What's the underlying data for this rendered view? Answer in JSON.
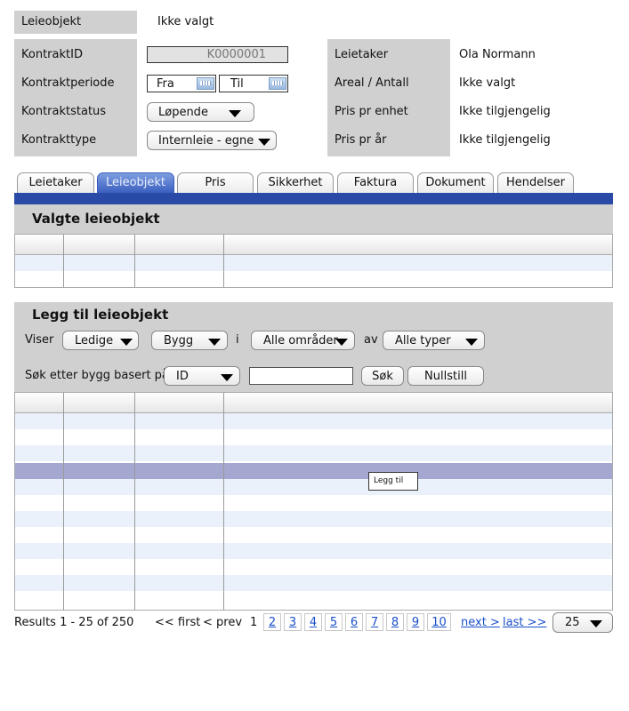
{
  "header": {
    "leieobjekt_label": "Leieobjekt",
    "leieobjekt_value": "Ikke valgt"
  },
  "contract": {
    "kontraktid_label": "KontraktID",
    "kontraktid_value": "K0000001",
    "kontraktperiode_label": "Kontraktperiode",
    "fra_label": "Fra",
    "til_label": "Til",
    "kontraktstatus_label": "Kontraktstatus",
    "kontraktstatus_value": "Løpende",
    "kontrakttype_label": "Kontrakttype",
    "kontrakttype_value": "Internleie - egne"
  },
  "summary": {
    "leietaker_label": "Leietaker",
    "leietaker_value": "Ola Normann",
    "areal_label": "Areal / Antall",
    "areal_value": "Ikke valgt",
    "pris_enhet_label": "Pris pr enhet",
    "pris_enhet_value": "Ikke tilgjengelig",
    "pris_aar_label": "Pris pr år",
    "pris_aar_value": "Ikke tilgjengelig"
  },
  "tabs": [
    {
      "label": "Leietaker"
    },
    {
      "label": "Leieobjekt"
    },
    {
      "label": "Pris"
    },
    {
      "label": "Sikkerhet"
    },
    {
      "label": "Faktura"
    },
    {
      "label": "Dokument"
    },
    {
      "label": "Hendelser"
    }
  ],
  "selected_section": {
    "title": "Valgte leieobjekt"
  },
  "add_section": {
    "title": "Legg til leieobjekt",
    "viser_label": "Viser",
    "filter_status": "Ledige",
    "filter_type": "Bygg",
    "i_label": "i",
    "filter_area": "Alle områder",
    "av_label": "av",
    "filter_kind": "Alle typer",
    "search_label": "Søk etter bygg basert på",
    "search_field": "ID",
    "search_value": "",
    "search_button": "Søk",
    "reset_button": "Nullstill",
    "add_tooltip": "Legg til"
  },
  "pagination": {
    "results_text": "Results 1 - 25 of 250",
    "first": "<< first",
    "prev": "< prev",
    "current": "1",
    "pages": [
      "2",
      "3",
      "4",
      "5",
      "6",
      "7",
      "8",
      "9",
      "10"
    ],
    "next": "next >",
    "last": "last >>",
    "per_page": "25"
  },
  "colors": {
    "panel_grey": "#d0d0d0",
    "tab_active": "#3a5fbf",
    "tab_bar": "#2a4aa8",
    "row_alt": "#eaf1fb",
    "row_selected": "#a4a8d0",
    "link": "#1a4fc9"
  }
}
